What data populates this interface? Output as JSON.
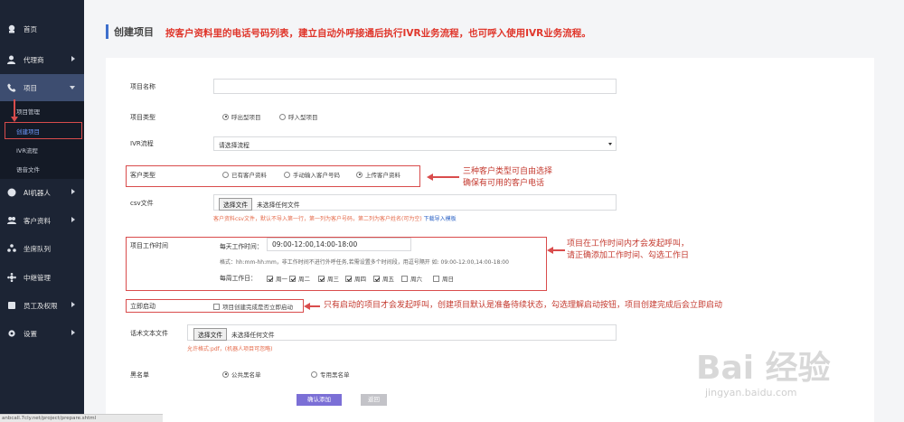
{
  "sidebar": {
    "items": [
      {
        "label": "首页",
        "icon": "dashboard-icon"
      },
      {
        "label": "代理商",
        "icon": "user-icon"
      },
      {
        "label": "项目",
        "icon": "phone-icon"
      },
      {
        "label": "AI机器人",
        "icon": "robot-icon"
      },
      {
        "label": "客户资料",
        "icon": "users-icon"
      },
      {
        "label": "坐席队列",
        "icon": "queue-icon"
      },
      {
        "label": "中继管理",
        "icon": "relay-icon"
      },
      {
        "label": "员工及权限",
        "icon": "staff-icon"
      },
      {
        "label": "设置",
        "icon": "gear-icon"
      }
    ],
    "sub_items": [
      {
        "label": "项目管理"
      },
      {
        "label": "创建项目"
      },
      {
        "label": "IVR流程"
      },
      {
        "label": "语音文件"
      }
    ]
  },
  "header": {
    "title": "创建项目",
    "description": "按客户资料里的电话号码列表，建立自动外呼接通后执行IVR业务流程，也可呼入使用IVR业务流程。"
  },
  "form": {
    "project_name_label": "项目名称",
    "project_name_value": "",
    "project_type_label": "项目类型",
    "project_type_options": [
      "呼出型项目",
      "呼入型项目"
    ],
    "ivr_label": "IVR流程",
    "ivr_value": "请选择流程",
    "customer_type_label": "客户类型",
    "customer_type_options": [
      "已有客户资料",
      "手动输入客户号码",
      "上传客户资料"
    ],
    "csv_label": "csv文件",
    "choose_file": "选择文件",
    "no_file": "未选择任何文件",
    "csv_hint": "客户资料csv文件，默认不导入第一行，第一列为客户号码，第二列为客户姓名(可为空)",
    "csv_download": "下载导入模板",
    "work_time_label": "项目工作时间",
    "daily_time_label": "每天工作时间：",
    "daily_time_value": "09:00-12:00,14:00-18:00",
    "time_format_hint": "格式：hh:mm-hh:mm，非工作时间不进行外呼任务,若需设置多个时间段，用逗号隔开 如: 09:00-12:00,14:00-18:00",
    "weekly_label": "每周工作日：",
    "weekdays": [
      {
        "label": "周一",
        "checked": true
      },
      {
        "label": "周二",
        "checked": true
      },
      {
        "label": "周三",
        "checked": true
      },
      {
        "label": "周四",
        "checked": true
      },
      {
        "label": "周五",
        "checked": true
      },
      {
        "label": "周六",
        "checked": false
      },
      {
        "label": "周日",
        "checked": false
      }
    ],
    "start_now_label": "立即启动",
    "start_now_checkbox": "项目创建完成是否立即启动",
    "script_label": "话术文本文件",
    "script_hint": "允许格式:pdf，(机器人项目可忽略)",
    "blacklist_label": "黑名单",
    "blacklist_options": [
      "公共黑名单",
      "专用黑名单"
    ],
    "confirm_button": "确认添加",
    "back_button": "返回"
  },
  "annotations": {
    "customer_type_note_1": "三种客户类型可自由选择",
    "customer_type_note_2": "确保有可用的客户电话",
    "work_time_note_1": "项目在工作时间内才会发起呼叫，",
    "work_time_note_2": "请正确添加工作时间、勾选工作日",
    "start_note": "只有启动的项目才会发起呼叫，创建项目默认是准备待续状态，勾选理解启动按钮，项目创建完成后会立即启动"
  },
  "watermark": {
    "brand": "Bai 经验",
    "url": "jingyan.baidu.com"
  },
  "status_bar": "anbcall.7cly.net/project/prepare.shtml",
  "colors": {
    "sidebar_bg": "#1c2434",
    "accent_red": "#e0362b",
    "confirm_btn": "#7b6fd6",
    "back_btn": "#c3c3c8"
  }
}
